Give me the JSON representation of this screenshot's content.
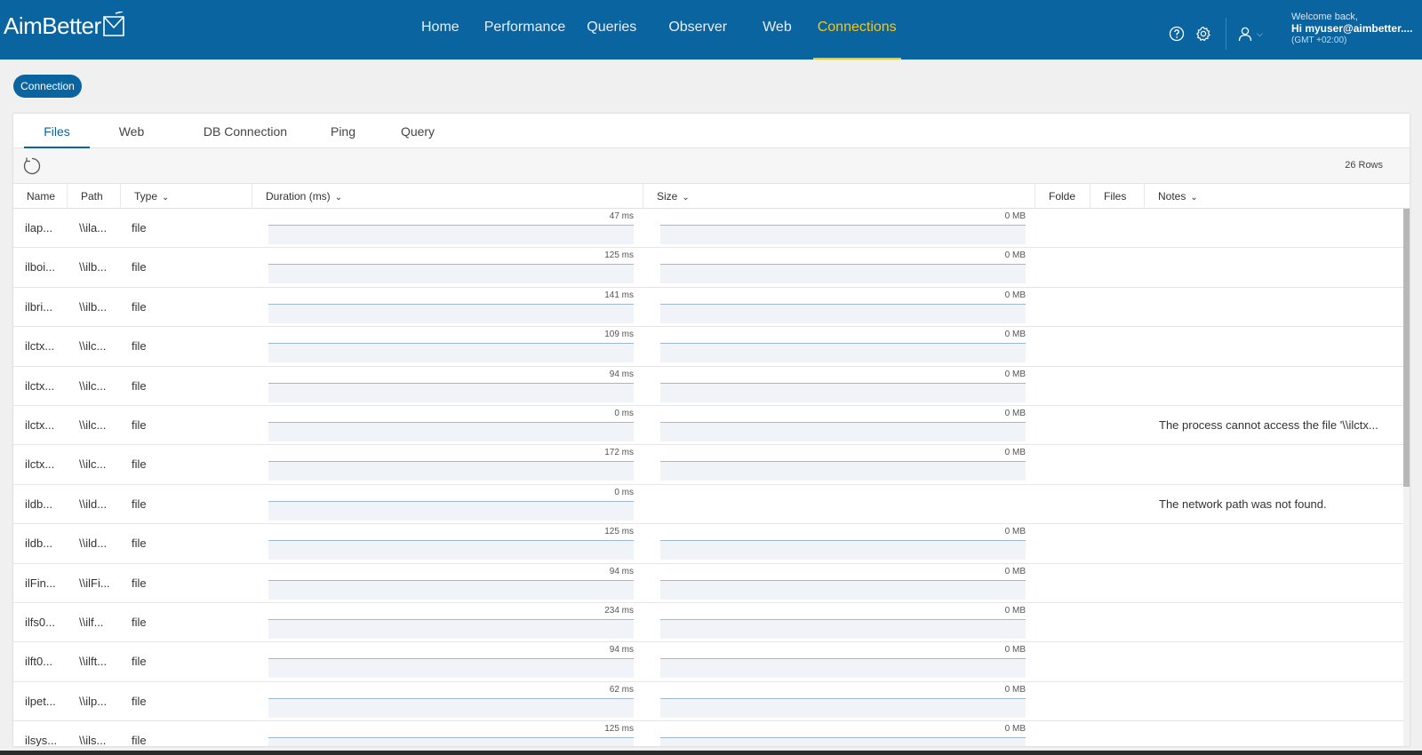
{
  "brand": {
    "name": "AimBetter"
  },
  "nav": [
    {
      "label": "Home",
      "active": false
    },
    {
      "label": "Performance",
      "active": false
    },
    {
      "label": "Queries",
      "active": false
    },
    {
      "label": "Observer",
      "active": false
    },
    {
      "label": "Web",
      "active": false
    },
    {
      "label": "Connections",
      "active": true
    }
  ],
  "user": {
    "welcome": "Welcome back,",
    "greeting": "Hi myuser@aimbetter....",
    "timezone": "(GMT +02:00)",
    "icons": [
      "help-icon",
      "settings-icon",
      "user-icon"
    ]
  },
  "connection_button": "Connection",
  "tabs": [
    {
      "label": "Files",
      "active": true
    },
    {
      "label": "Web",
      "active": false
    },
    {
      "label": "DB Connection",
      "active": false
    },
    {
      "label": "Ping",
      "active": false
    },
    {
      "label": "Query",
      "active": false
    }
  ],
  "toolbar": {
    "row_count": "26 Rows",
    "refresh_icon": "refresh-icon"
  },
  "columns": [
    "Name",
    "Path",
    "Type",
    "Duration (ms)",
    "Size",
    "Folde",
    "Files",
    "Notes"
  ],
  "rows": [
    {
      "name": "ilap...",
      "path": "\\\\ila...",
      "type": "file",
      "duration": "47 ms",
      "size": "0 MB",
      "notes": ""
    },
    {
      "name": "ilboi...",
      "path": "\\\\ilb...",
      "type": "file",
      "duration": "125 ms",
      "size": "0 MB",
      "notes": ""
    },
    {
      "name": "ilbri...",
      "path": "\\\\ilb...",
      "type": "file",
      "duration": "141 ms",
      "size": "0 MB",
      "notes": ""
    },
    {
      "name": "ilctx...",
      "path": "\\\\ilc...",
      "type": "file",
      "duration": "109 ms",
      "size": "0 MB",
      "notes": ""
    },
    {
      "name": "ilctx...",
      "path": "\\\\ilc...",
      "type": "file",
      "duration": "94 ms",
      "size": "0 MB",
      "notes": ""
    },
    {
      "name": "ilctx...",
      "path": "\\\\ilc...",
      "type": "file",
      "duration": "0 ms",
      "size": "0 MB",
      "notes": "The process cannot access the file '\\\\ilctx..."
    },
    {
      "name": "ilctx...",
      "path": "\\\\ilc...",
      "type": "file",
      "duration": "172 ms",
      "size": "0 MB",
      "notes": ""
    },
    {
      "name": "ildb...",
      "path": "\\\\ild...",
      "type": "file",
      "duration": "0 ms",
      "size": "",
      "notes": "The network path was not found."
    },
    {
      "name": "ildb...",
      "path": "\\\\ild...",
      "type": "file",
      "duration": "125 ms",
      "size": "0 MB",
      "notes": ""
    },
    {
      "name": "ilFin...",
      "path": "\\\\ilFi...",
      "type": "file",
      "duration": "94 ms",
      "size": "0 MB",
      "notes": ""
    },
    {
      "name": "ilfs0...",
      "path": "\\\\ilf...",
      "type": "file",
      "duration": "234 ms",
      "size": "0 MB",
      "notes": ""
    },
    {
      "name": "ilft0...",
      "path": "\\\\ilft...",
      "type": "file",
      "duration": "94 ms",
      "size": "0 MB",
      "notes": ""
    },
    {
      "name": "ilpet...",
      "path": "\\\\ilp...",
      "type": "file",
      "duration": "62 ms",
      "size": "0 MB",
      "notes": ""
    },
    {
      "name": "ilsys...",
      "path": "\\\\ils...",
      "type": "file",
      "duration": "125 ms",
      "size": "0 MB",
      "notes": ""
    }
  ],
  "colors": {
    "brand_blue": "#0a64a0",
    "active_yellow": "#f5c518"
  }
}
